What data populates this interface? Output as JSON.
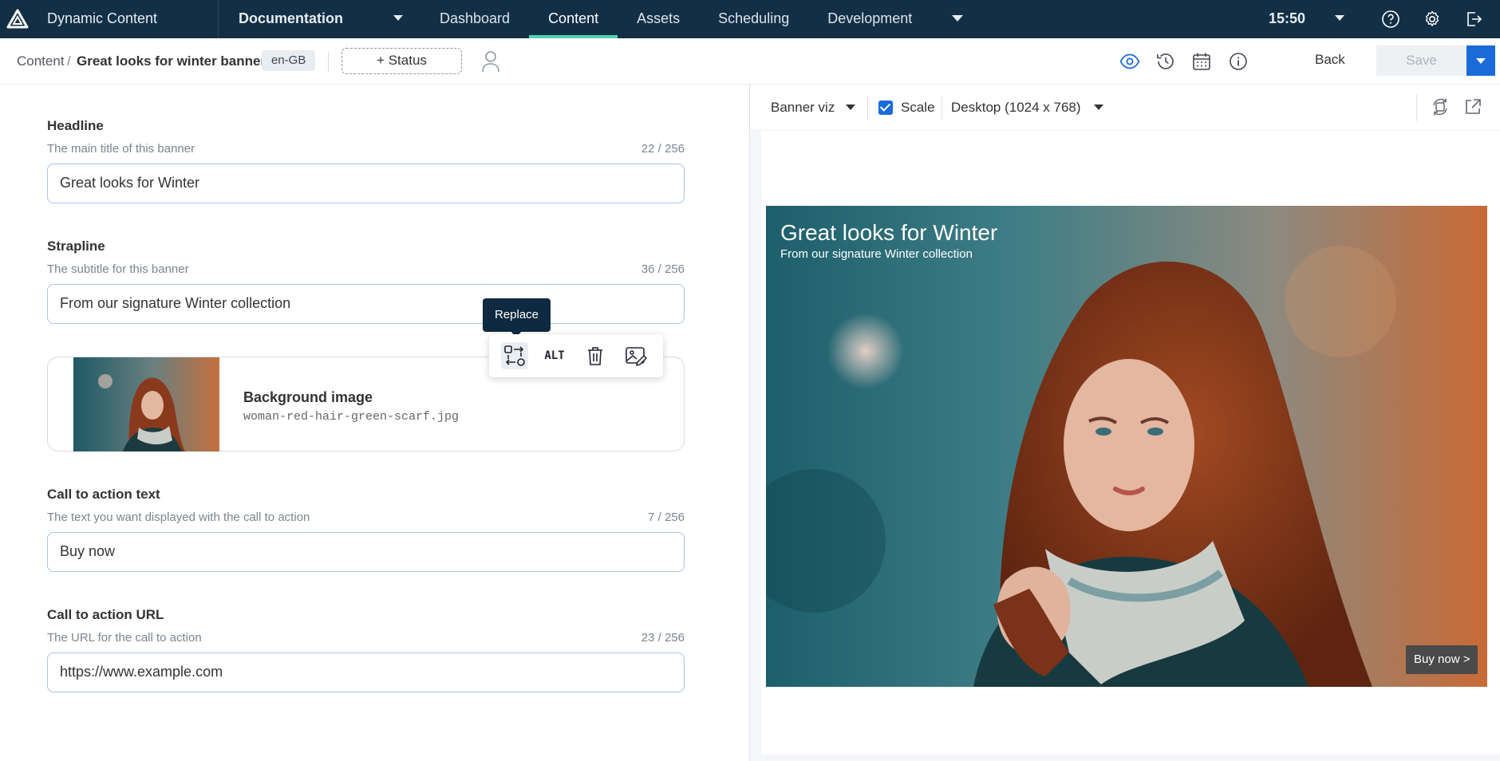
{
  "topbar": {
    "app_title": "Dynamic Content",
    "hub": "Documentation",
    "tabs": [
      {
        "label": "Dashboard"
      },
      {
        "label": "Content",
        "active": true
      },
      {
        "label": "Assets"
      },
      {
        "label": "Scheduling"
      },
      {
        "label": "Development"
      }
    ],
    "time": "15:50",
    "icons": [
      "help-icon",
      "gear-icon",
      "logout-icon"
    ]
  },
  "subbar": {
    "breadcrumb_root": "Content",
    "breadcrumb_sep": "/",
    "breadcrumb_current": "Great looks for winter banner",
    "locale": "en-GB",
    "status_label": "+ Status",
    "icons": [
      "eye-icon",
      "history-icon",
      "calendar-icon",
      "info-icon"
    ],
    "back_label": "Back",
    "save_label": "Save"
  },
  "form": {
    "headline": {
      "label": "Headline",
      "help": "The main title of this banner",
      "count": "22 / 256",
      "value": "Great looks for Winter"
    },
    "strapline": {
      "label": "Strapline",
      "help": "The subtitle for this banner",
      "count": "36 / 256",
      "value": "From our signature Winter collection"
    },
    "media": {
      "label": "Background image",
      "file": "woman-red-hair-green-scarf.jpg"
    },
    "cta_text": {
      "label": "Call to action text",
      "help": "The text you want displayed with the call to action",
      "count": "7 / 256",
      "value": "Buy now"
    },
    "cta_url": {
      "label": "Call to action URL",
      "help": "The URL for the call to action",
      "count": "23 / 256",
      "value": "https://www.example.com"
    }
  },
  "media_toolbar": {
    "tooltip": "Replace",
    "alt_label": "ALT",
    "icons": [
      "replace-icon",
      "alt-icon",
      "trash-icon",
      "edit-image-icon"
    ]
  },
  "preview": {
    "visualization": "Banner viz",
    "scale_label": "Scale",
    "scale_checked": true,
    "device": "Desktop (1024 x 768)",
    "icons": [
      "rotate-icon",
      "external-link-icon"
    ],
    "banner": {
      "headline": "Great looks for Winter",
      "strapline": "From our signature Winter collection",
      "cta": "Buy now >"
    }
  },
  "colors": {
    "topbar": "#132f46",
    "active_tab": "#4fd3b0",
    "primary": "#1a6bd9"
  }
}
